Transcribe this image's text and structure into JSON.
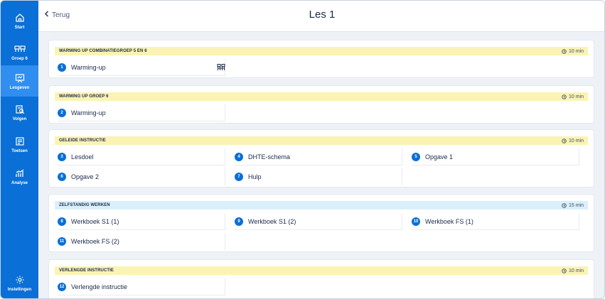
{
  "sidebar": {
    "items": [
      {
        "label": "Start",
        "icon": "home-icon"
      },
      {
        "label": "Groep 6",
        "icon": "group-icon"
      },
      {
        "label": "Lesgeven",
        "icon": "board-icon",
        "active": true
      },
      {
        "label": "Volgen",
        "icon": "clipboard-search-icon"
      },
      {
        "label": "Toetsen",
        "icon": "test-icon"
      },
      {
        "label": "Analyse",
        "icon": "chart-icon"
      }
    ],
    "settings_label": "Instellingen"
  },
  "header": {
    "back_label": "Terug",
    "title": "Les 1"
  },
  "sections": [
    {
      "title": "WARMING UP COMBINATIEGROEP 5 EN 6",
      "duration": "10 min",
      "items": [
        {
          "num": "1",
          "label": "Warming-up"
        }
      ]
    },
    {
      "title": "WARMING UP GROEP 6",
      "duration": "10 min",
      "items": [
        {
          "num": "2",
          "label": "Warming-up"
        }
      ]
    },
    {
      "title": "GELEIDE INSTRUCTIE",
      "duration": "10 min",
      "items": [
        {
          "num": "3",
          "label": "Lesdoel"
        },
        {
          "num": "4",
          "label": "DHTE-schema"
        },
        {
          "num": "5",
          "label": "Opgave 1"
        },
        {
          "num": "6",
          "label": "Opgave 2"
        },
        {
          "num": "7",
          "label": "Hulp"
        }
      ]
    },
    {
      "title": "ZELFSTANDIG WERKEN",
      "duration": "15 min",
      "items": [
        {
          "num": "8",
          "label": "Werkboek S1 (1)"
        },
        {
          "num": "9",
          "label": "Werkboek S1 (2)"
        },
        {
          "num": "10",
          "label": "Werkboek FS (1)"
        },
        {
          "num": "11",
          "label": "Werkboek FS (2)"
        }
      ]
    },
    {
      "title": "VERLENGDE INSTRUCTIE",
      "duration": "10 min",
      "items": [
        {
          "num": "12",
          "label": "Verlengde instructie"
        }
      ]
    }
  ],
  "colors": {
    "sidebar": "#0a6fd6",
    "sidebar_active": "#2f8ef0",
    "badge": "#0a6fd6",
    "section_header_yellow": "#fbf3b3",
    "section_header_blue": "#dbeffb"
  }
}
